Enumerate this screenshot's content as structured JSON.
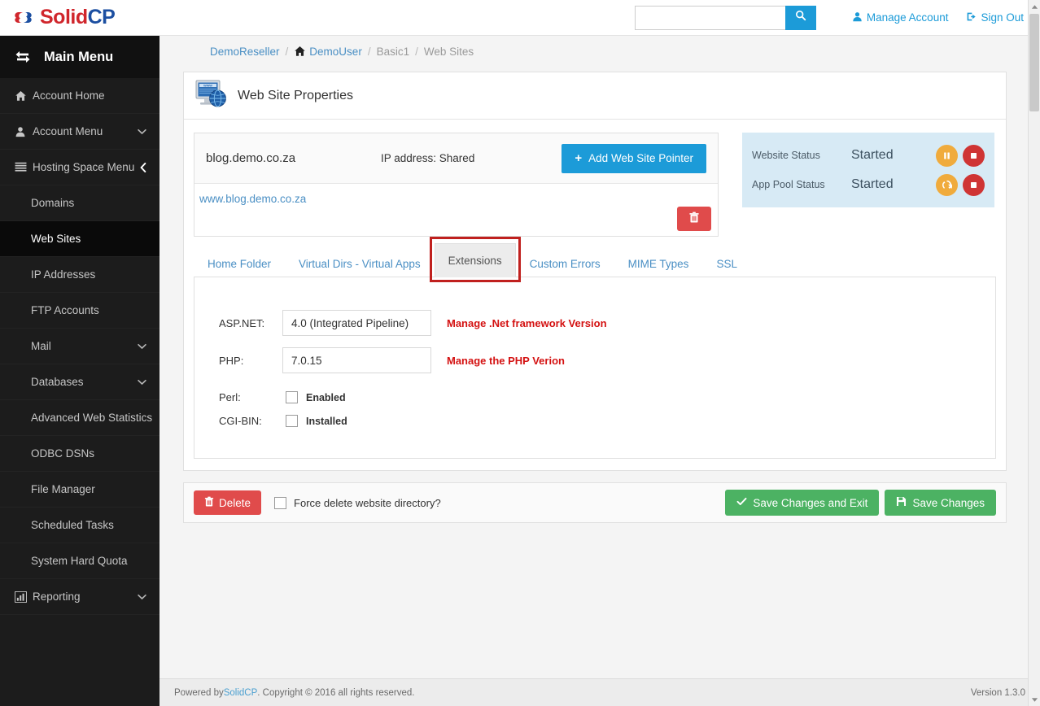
{
  "topbar": {
    "logo": {
      "part1": "Solid",
      "part2": "CP",
      "icon": "cloud-logo-icon",
      "color1": "#d0262c",
      "color2": "#1c4fa1"
    },
    "search": {
      "value": "",
      "placeholder": "",
      "icon": "search-icon",
      "button_color": "#1c9bd8"
    },
    "manage_account": {
      "label": "Manage Account",
      "icon": "user-icon"
    },
    "sign_out": {
      "label": "Sign Out",
      "icon": "sign-out-icon"
    }
  },
  "sidebar": {
    "header": {
      "label": "Main Menu",
      "icon": "exchange-arrows-icon"
    },
    "items": [
      {
        "label": "Account Home",
        "icon": "home-icon",
        "level": 0,
        "active": false,
        "chevron": ""
      },
      {
        "label": "Account Menu",
        "icon": "user-icon",
        "level": 0,
        "active": false,
        "chevron": "chevron-down-icon"
      },
      {
        "label": "Hosting Space Menu",
        "icon": "list-icon",
        "level": 0,
        "active": false,
        "chevron": "chevron-left-icon"
      },
      {
        "label": "Domains",
        "icon": "",
        "level": 1,
        "active": false,
        "chevron": ""
      },
      {
        "label": "Web Sites",
        "icon": "",
        "level": 1,
        "active": true,
        "chevron": ""
      },
      {
        "label": "IP Addresses",
        "icon": "",
        "level": 1,
        "active": false,
        "chevron": ""
      },
      {
        "label": "FTP Accounts",
        "icon": "",
        "level": 1,
        "active": false,
        "chevron": ""
      },
      {
        "label": "Mail",
        "icon": "",
        "level": 1,
        "active": false,
        "chevron": "chevron-down-icon"
      },
      {
        "label": "Databases",
        "icon": "",
        "level": 1,
        "active": false,
        "chevron": "chevron-down-icon"
      },
      {
        "label": "Advanced Web Statistics",
        "icon": "",
        "level": 1,
        "active": false,
        "chevron": ""
      },
      {
        "label": "ODBC DSNs",
        "icon": "",
        "level": 1,
        "active": false,
        "chevron": ""
      },
      {
        "label": "File Manager",
        "icon": "",
        "level": 1,
        "active": false,
        "chevron": ""
      },
      {
        "label": "Scheduled Tasks",
        "icon": "",
        "level": 1,
        "active": false,
        "chevron": ""
      },
      {
        "label": "System Hard Quota",
        "icon": "",
        "level": 1,
        "active": false,
        "chevron": ""
      },
      {
        "label": "Reporting",
        "icon": "chart-bar-icon",
        "level": 0,
        "active": false,
        "chevron": "chevron-down-icon"
      }
    ]
  },
  "breadcrumb": {
    "items": [
      {
        "label": "DemoReseller",
        "link": true,
        "icon": ""
      },
      {
        "label": "DemoUser",
        "link": true,
        "icon": "home-icon"
      },
      {
        "label": "Basic1",
        "link": false,
        "icon": ""
      },
      {
        "label": "Web Sites",
        "link": false,
        "icon": ""
      }
    ],
    "separator": "/"
  },
  "page": {
    "title": "Web Site Properties",
    "title_icon": "website-monitor-globe-icon"
  },
  "site": {
    "domain": "blog.demo.co.za",
    "ip_address": "IP address: Shared",
    "add_pointer_label": "Add Web Site Pointer",
    "add_pointer_icon": "plus-icon",
    "pointer": "www.blog.demo.co.za",
    "pointer_delete_icon": "trash-icon"
  },
  "status_panel": {
    "rows": [
      {
        "label": "Website Status",
        "value": "Started",
        "buttons": [
          {
            "icon": "pause-icon",
            "color": "#f0ab3c"
          },
          {
            "icon": "stop-icon",
            "color": "#cf3434"
          }
        ]
      },
      {
        "label": "App Pool Status",
        "value": "Started",
        "buttons": [
          {
            "icon": "recycle-icon",
            "color": "#f0ab3c"
          },
          {
            "icon": "stop-icon",
            "color": "#cf3434"
          }
        ]
      }
    ],
    "background": "#d7eaf5"
  },
  "tabs": [
    {
      "label": "Home Folder",
      "active": false
    },
    {
      "label": "Virtual Dirs - Virtual Apps",
      "active": false
    },
    {
      "label": "Extensions",
      "active": true
    },
    {
      "label": "Custom Errors",
      "active": false
    },
    {
      "label": "MIME Types",
      "active": false
    },
    {
      "label": "SSL",
      "active": false
    }
  ],
  "highlight": {
    "color": "#c0201e",
    "target": "Extensions"
  },
  "extensions_form": {
    "aspnet": {
      "label": "ASP.NET:",
      "value": "4.0 (Integrated Pipeline)",
      "note": "Manage .Net framework Version"
    },
    "php": {
      "label": "PHP:",
      "value": "7.0.15",
      "note": "Manage the PHP Verion"
    },
    "perl": {
      "label": "Perl:",
      "checkbox_label": "Enabled",
      "checked": false
    },
    "cgibin": {
      "label": "CGI-BIN:",
      "checkbox_label": "Installed",
      "checked": false
    },
    "note_color": "#d41212"
  },
  "action_bar": {
    "delete_label": "Delete",
    "delete_icon": "trash-icon",
    "force_delete_label": "Force delete website directory?",
    "force_delete_checked": false,
    "save_exit_label": "Save Changes and Exit",
    "save_exit_icon": "check-icon",
    "save_label": "Save Changes",
    "save_icon": "floppy-disk-icon"
  },
  "footer": {
    "powered_prefix": "Powered by ",
    "brand": "SolidCP",
    "copyright": ". Copyright © 2016 all rights reserved.",
    "version": "Version 1.3.0"
  }
}
